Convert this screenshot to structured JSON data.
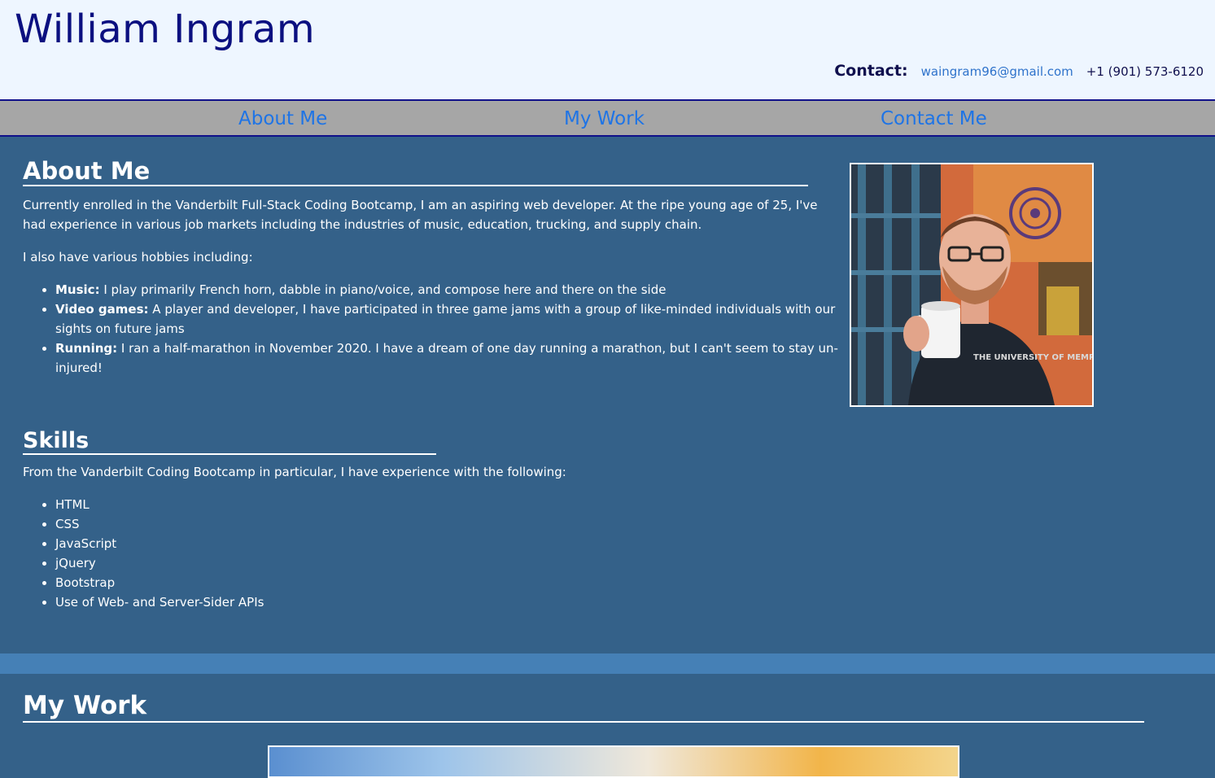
{
  "header": {
    "name": "William Ingram",
    "contact_label": "Contact:",
    "email": "waingram96@gmail.com",
    "phone": "+1 (901) 573-6120"
  },
  "nav": {
    "items": [
      "About Me",
      "My Work",
      "Contact Me"
    ]
  },
  "about": {
    "title": "About Me",
    "intro": "Currently enrolled in the Vanderbilt Full-Stack Coding Bootcamp, I am an aspiring web developer. At the ripe young age of 25, I've had experience in various job markets including the industries of music, education, trucking, and supply chain.",
    "hobbies_intro": "I also have various hobbies including:",
    "hobbies": [
      {
        "label": "Music:",
        "text": " I play primarily French horn, dabble in piano/voice, and compose here and there on the side"
      },
      {
        "label": "Video games:",
        "text": " A player and developer, I have participated in three game jams with a group of like-minded individuals with our sights on future jams"
      },
      {
        "label": "Running:",
        "text": " I ran a half-marathon in November 2020. I have a dream of one day running a marathon, but I can't seem to stay un-injured!"
      }
    ],
    "photo_shirt_text": "THE UNIVERSITY OF MEMPHIS"
  },
  "skills": {
    "title": "Skills",
    "intro": "From the Vanderbilt Coding Bootcamp in particular, I have experience with the following:",
    "items": [
      "HTML",
      "CSS",
      "JavaScript",
      "jQuery",
      "Bootstrap",
      "Use of Web- and Server-Sider APIs"
    ]
  },
  "work": {
    "title": "My Work"
  },
  "colors": {
    "background": "#346189",
    "header_bg": "#eef6ff",
    "nav_bg": "#a6a6a6",
    "link": "#1e74e6",
    "band": "#4580b6"
  }
}
